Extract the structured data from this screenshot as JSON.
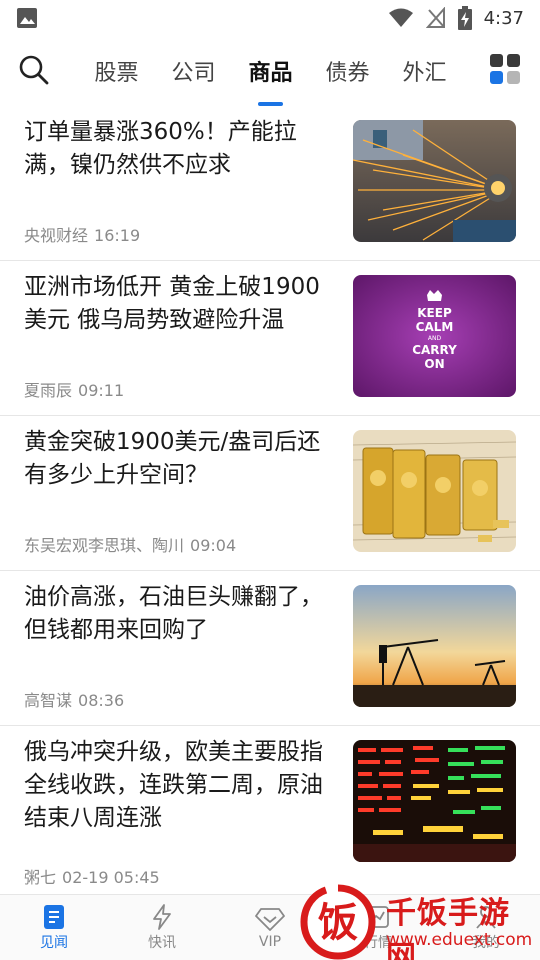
{
  "status_bar": {
    "time": "4:37"
  },
  "nav": {
    "tabs": [
      {
        "label": "股票"
      },
      {
        "label": "公司"
      },
      {
        "label": "商品"
      },
      {
        "label": "债券"
      },
      {
        "label": "外汇"
      }
    ],
    "active_tab": "商品",
    "accent_color": "#1b74e4"
  },
  "news": [
    {
      "title": "订单量暴涨360%！产能拉满，镍仍然供不应求",
      "source": "央视财经",
      "time": "16:19",
      "thumbnail_icon": "grinding-sparks-image"
    },
    {
      "title": "亚洲市场低开 黄金上破1900美元 俄乌局势致避险升温",
      "source": "夏雨辰",
      "time": "09:11",
      "thumbnail_icon": "keep-calm-poster-image",
      "thumbnail_text": [
        "KEEP",
        "CALM",
        "AND",
        "CARRY",
        "ON"
      ]
    },
    {
      "title": "黄金突破1900美元/盎司后还有多少上升空间？",
      "source": "东吴宏观李思琪、陶川",
      "time": "09:04",
      "thumbnail_icon": "gold-bars-image"
    },
    {
      "title": "油价高涨，石油巨头赚翻了，但钱都用来回购了",
      "source": "高智谋",
      "time": "08:36",
      "thumbnail_icon": "oil-pump-sunset-image"
    },
    {
      "title": "俄乌冲突升级，欧美主要股指全线收跌，连跌第二周，原油结束八周连涨",
      "source": "粥七",
      "time": "02-19 05:45",
      "thumbnail_icon": "stock-board-image"
    }
  ],
  "bottom_tabs": [
    {
      "label": "见闻",
      "icon": "document-icon"
    },
    {
      "label": "快讯",
      "icon": "lightning-icon"
    },
    {
      "label": "VIP",
      "icon": "diamond-icon"
    },
    {
      "label": "行情",
      "icon": "chart-icon"
    },
    {
      "label": "我的",
      "icon": "user-icon"
    }
  ],
  "watermark": {
    "title": "千饭手游网",
    "url": "www.eduext.com",
    "logo_char": "饭"
  }
}
